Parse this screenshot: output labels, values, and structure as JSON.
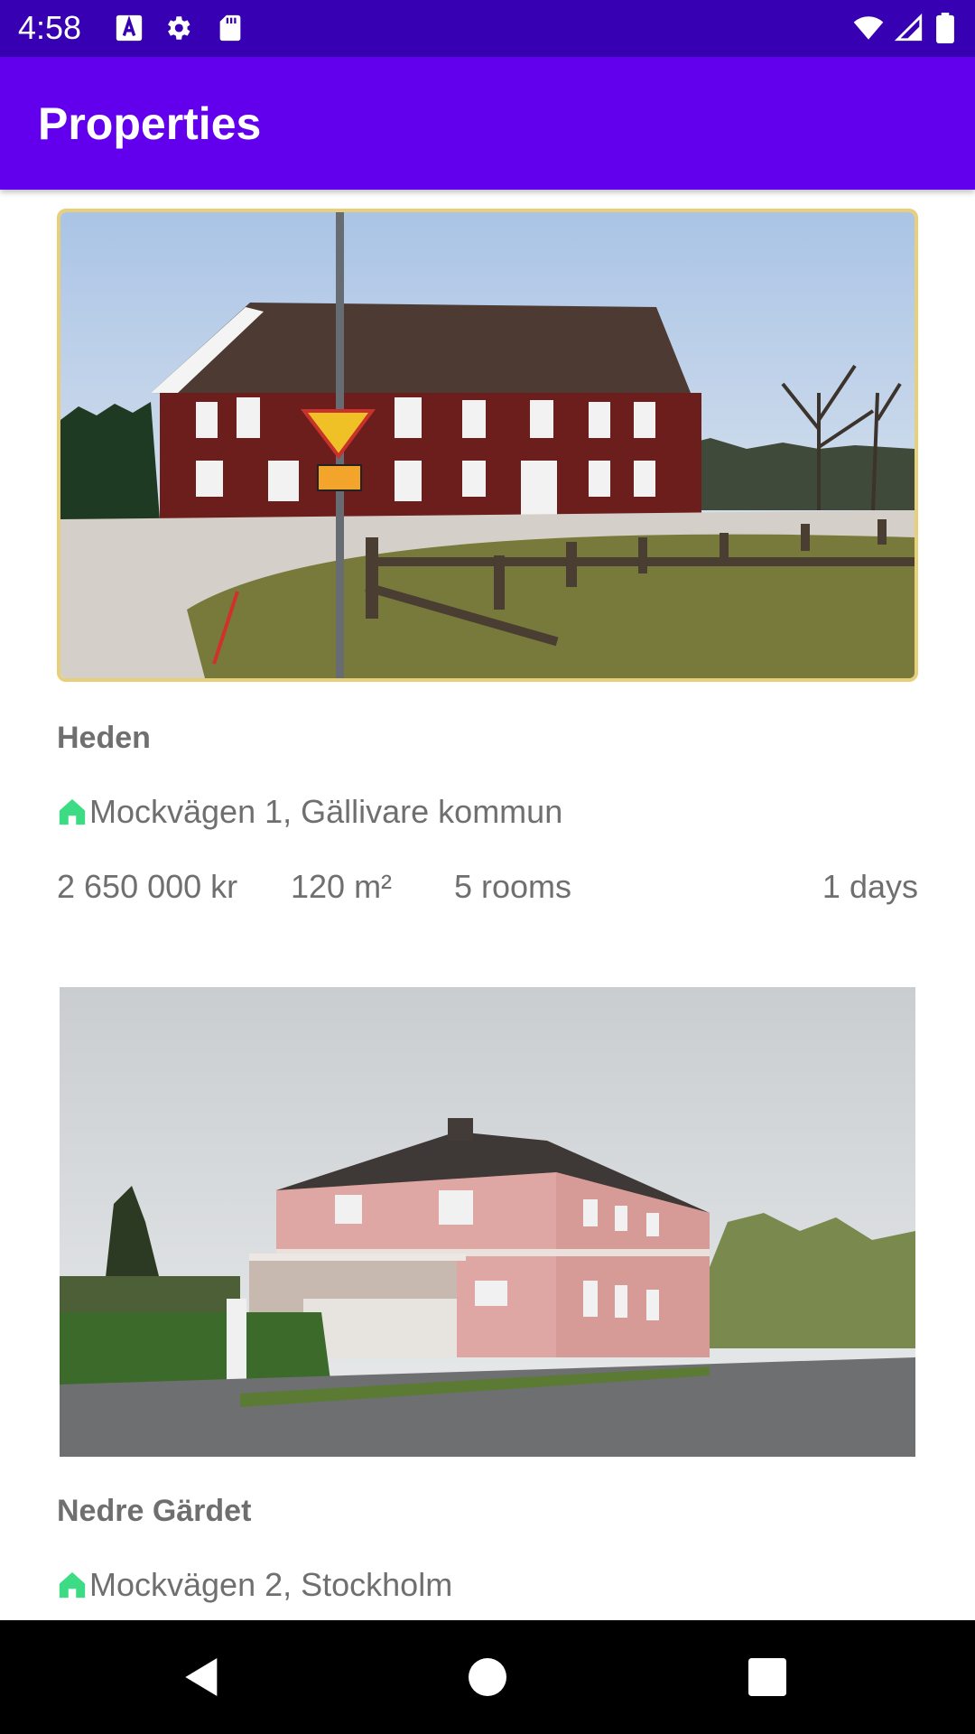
{
  "status_bar": {
    "time": "4:58",
    "icons": [
      "text-a-icon",
      "gear-icon",
      "sd-card-icon",
      "wifi-icon",
      "signal-icon",
      "battery-icon"
    ],
    "background": "#3700b3"
  },
  "app_bar": {
    "title": "Properties",
    "background": "#6200ee"
  },
  "properties": [
    {
      "name": "Heden",
      "address": "Mockvägen 1, Gällivare kommun",
      "price": "2 650 000 kr",
      "area": "120 m²",
      "rooms": "5 rooms",
      "age": "1 days",
      "selected": true,
      "photo": "red-wooden-house-photo"
    },
    {
      "name": "Nedre Gärdet",
      "address": "Mockvägen 2, Stockholm",
      "selected": false,
      "photo": "pink-house-photo"
    }
  ],
  "colors": {
    "accent_icon": "#3ddc84",
    "selected_border": "#e8cf79",
    "text": "#6f6f6f"
  },
  "nav_bar": {
    "buttons": [
      "back-icon",
      "home-icon",
      "recents-icon"
    ]
  }
}
